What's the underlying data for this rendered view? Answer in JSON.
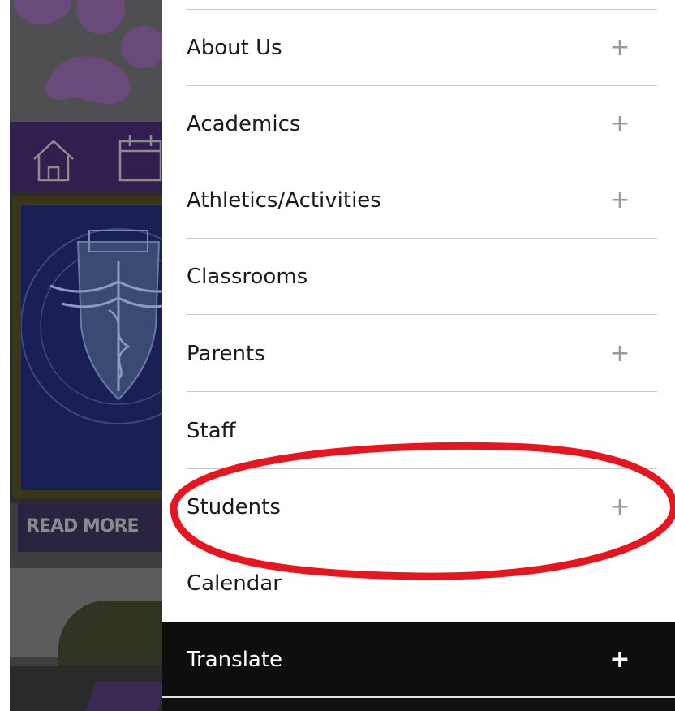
{
  "background_page": {
    "read_more_label": "READ MORE"
  },
  "menu": {
    "items": [
      {
        "label": "About Us",
        "expandable": true
      },
      {
        "label": "Academics",
        "expandable": true
      },
      {
        "label": "Athletics/Activities",
        "expandable": true
      },
      {
        "label": "Classrooms",
        "expandable": false
      },
      {
        "label": "Parents",
        "expandable": true
      },
      {
        "label": "Staff",
        "expandable": false
      },
      {
        "label": "Students",
        "expandable": true
      },
      {
        "label": "Calendar",
        "expandable": false
      }
    ],
    "expand_symbol": "+",
    "translate": {
      "label": "Translate",
      "symbol": "+"
    }
  },
  "colors": {
    "annotation": "#e8141e",
    "translate_bg": "#0e0e0e",
    "divider": "#c8c8c8",
    "plus_icon": "#9a9a9a",
    "school_purple": "#311f4f"
  },
  "icons": {
    "home": "home-icon",
    "calendar": "calendar-icon",
    "paw": "paw-icon",
    "seal": "bst-academy-seal"
  }
}
